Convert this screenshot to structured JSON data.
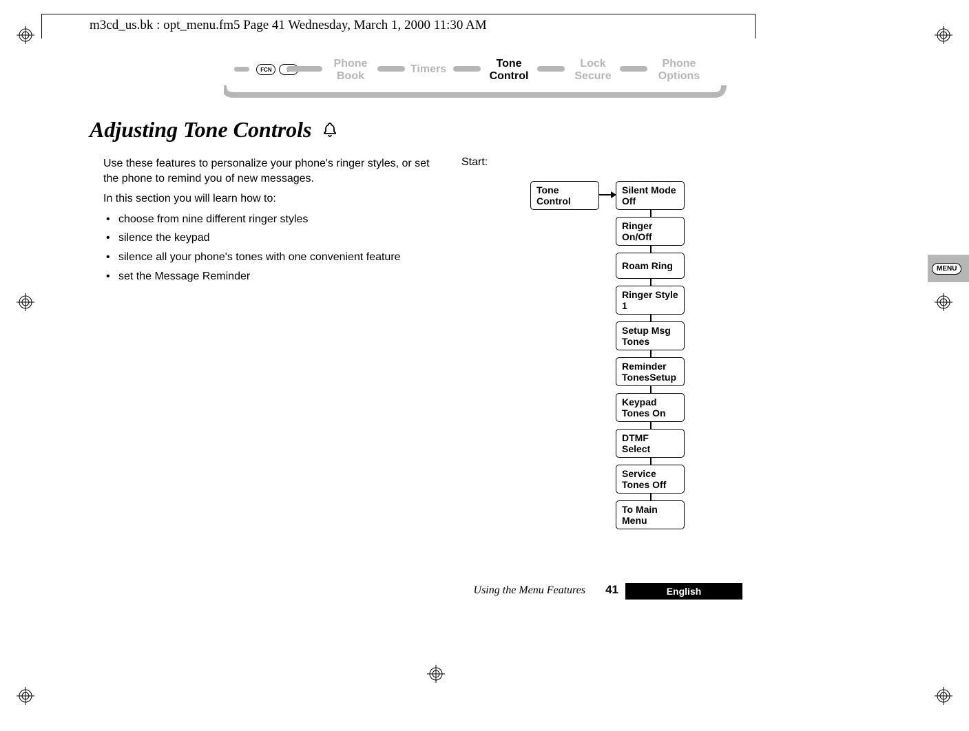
{
  "header": {
    "path_text": "m3cd_us.bk : opt_menu.fm5  Page 41  Wednesday, March 1, 2000  11:30 AM"
  },
  "nav": {
    "fcn_label": "FCN",
    "one_label": "1",
    "items": [
      {
        "line1": "Phone",
        "line2": "Book",
        "active": false
      },
      {
        "line1": "Timers",
        "line2": "",
        "active": false
      },
      {
        "line1": "Tone",
        "line2": "Control",
        "active": true
      },
      {
        "line1": "Lock",
        "line2": "Secure",
        "active": false
      },
      {
        "line1": "Phone",
        "line2": "Options",
        "active": false
      }
    ]
  },
  "heading": "Adjusting Tone Controls",
  "intro": {
    "p1": "Use these features to personalize your phone's ringer styles, or set the phone to remind you of new messages.",
    "p2": "In this section you will learn how to:",
    "bullets": [
      "choose from nine different ringer styles",
      "silence the keypad",
      "silence all your phone's tones with one convenient feature",
      "set the Message Reminder"
    ]
  },
  "diagram": {
    "start_label": "Start:",
    "parent": "Tone Control",
    "children": [
      "Silent Mode Off",
      "Ringer On/Off",
      "Roam Ring",
      "Ringer Style 1",
      "Setup Msg Tones",
      "Reminder TonesSetup",
      "Keypad Tones On",
      "DTMF Select",
      "Service Tones Off",
      "To Main Menu"
    ]
  },
  "footer": {
    "section": "Using the Menu Features",
    "page": "41",
    "language": "English"
  },
  "side_tab": {
    "menu_key": "MENU"
  },
  "icons": {
    "bell": "bell-icon",
    "registration_mark": "registration-mark"
  }
}
